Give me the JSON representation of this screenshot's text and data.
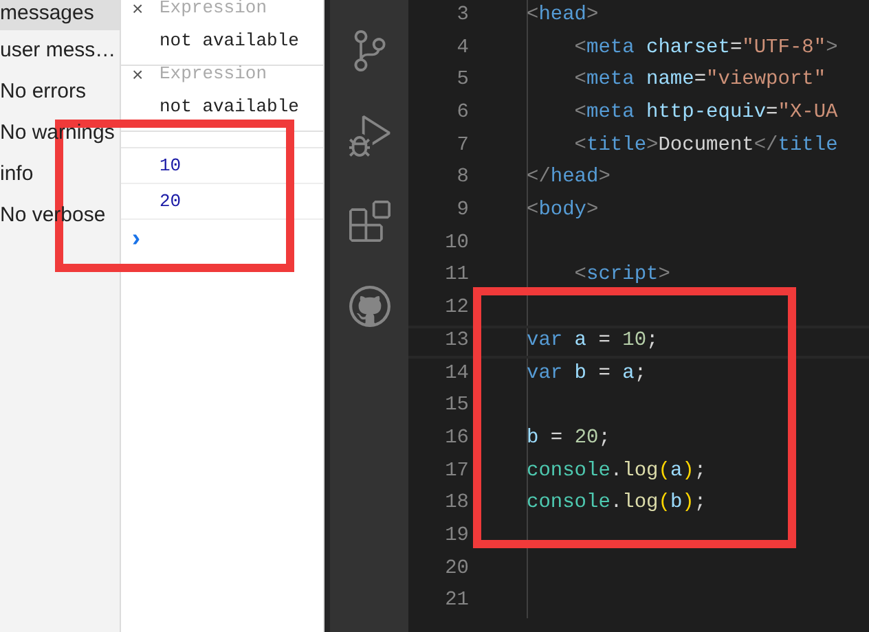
{
  "sidebar": {
    "items": [
      {
        "label": "messages",
        "selected": true
      },
      {
        "label": "user mess…",
        "selected": false
      },
      {
        "label": "No errors",
        "selected": false
      },
      {
        "label": "No warnings",
        "selected": false
      },
      {
        "label": "info",
        "selected": false
      },
      {
        "label": "No verbose",
        "selected": false
      }
    ]
  },
  "watch": [
    {
      "close": "×",
      "placeholder": "Expression",
      "value": "not available"
    },
    {
      "close": "×",
      "placeholder": "Expression",
      "value": "not available"
    }
  ],
  "console": {
    "output": [
      "10",
      "20"
    ],
    "prompt": "›"
  },
  "editor": {
    "lines": [
      {
        "number": "3",
        "current": false,
        "tokens": [
          {
            "text": "<",
            "kind": "punct"
          },
          {
            "text": "head",
            "kind": "tag"
          },
          {
            "text": ">",
            "kind": "punct"
          }
        ]
      },
      {
        "number": "4",
        "current": false,
        "tokens": [
          {
            "text": "    <",
            "kind": "punct"
          },
          {
            "text": "meta",
            "kind": "tag"
          },
          {
            "text": " charset",
            "kind": "attr"
          },
          {
            "text": "=",
            "kind": "plain"
          },
          {
            "text": "\"UTF-8\"",
            "kind": "string"
          },
          {
            "text": ">",
            "kind": "punct"
          }
        ]
      },
      {
        "number": "5",
        "current": false,
        "tokens": [
          {
            "text": "    <",
            "kind": "punct"
          },
          {
            "text": "meta",
            "kind": "tag"
          },
          {
            "text": " name",
            "kind": "attr"
          },
          {
            "text": "=",
            "kind": "plain"
          },
          {
            "text": "\"viewport\"",
            "kind": "string"
          }
        ]
      },
      {
        "number": "6",
        "current": false,
        "tokens": [
          {
            "text": "    <",
            "kind": "punct"
          },
          {
            "text": "meta",
            "kind": "tag"
          },
          {
            "text": " http-equiv",
            "kind": "attr"
          },
          {
            "text": "=",
            "kind": "plain"
          },
          {
            "text": "\"X-UA",
            "kind": "string"
          }
        ]
      },
      {
        "number": "7",
        "current": false,
        "tokens": [
          {
            "text": "    <",
            "kind": "punct"
          },
          {
            "text": "title",
            "kind": "tag"
          },
          {
            "text": ">",
            "kind": "punct"
          },
          {
            "text": "Document",
            "kind": "plain"
          },
          {
            "text": "</",
            "kind": "punct"
          },
          {
            "text": "title",
            "kind": "tag"
          }
        ]
      },
      {
        "number": "8",
        "current": false,
        "tokens": [
          {
            "text": "</",
            "kind": "punct"
          },
          {
            "text": "head",
            "kind": "tag"
          },
          {
            "text": ">",
            "kind": "punct"
          }
        ]
      },
      {
        "number": "9",
        "current": false,
        "tokens": [
          {
            "text": "<",
            "kind": "punct"
          },
          {
            "text": "body",
            "kind": "tag"
          },
          {
            "text": ">",
            "kind": "punct"
          }
        ]
      },
      {
        "number": "10",
        "current": false
      },
      {
        "number": "11",
        "current": false,
        "tokens": [
          {
            "text": "    <",
            "kind": "punct"
          },
          {
            "text": "script",
            "kind": "tag"
          },
          {
            "text": ">",
            "kind": "punct"
          }
        ]
      },
      {
        "number": "12",
        "current": false
      },
      {
        "number": "13",
        "current": true,
        "tokens": [
          {
            "text": "var",
            "kind": "keyword"
          },
          {
            "text": " a",
            "kind": "variable"
          },
          {
            "text": " = ",
            "kind": "plain"
          },
          {
            "text": "10",
            "kind": "number"
          },
          {
            "text": ";",
            "kind": "plain"
          }
        ]
      },
      {
        "number": "14",
        "current": false,
        "tokens": [
          {
            "text": "var",
            "kind": "keyword"
          },
          {
            "text": " b",
            "kind": "variable"
          },
          {
            "text": " = ",
            "kind": "plain"
          },
          {
            "text": "a",
            "kind": "variable"
          },
          {
            "text": ";",
            "kind": "plain"
          }
        ]
      },
      {
        "number": "15",
        "current": false
      },
      {
        "number": "16",
        "current": false,
        "tokens": [
          {
            "text": "b",
            "kind": "variable"
          },
          {
            "text": " = ",
            "kind": "plain"
          },
          {
            "text": "20",
            "kind": "number"
          },
          {
            "text": ";",
            "kind": "plain"
          }
        ]
      },
      {
        "number": "17",
        "current": false,
        "tokens": [
          {
            "text": "console",
            "kind": "class"
          },
          {
            "text": ".",
            "kind": "plain"
          },
          {
            "text": "log",
            "kind": "function"
          },
          {
            "text": "(",
            "kind": "paren"
          },
          {
            "text": "a",
            "kind": "variable"
          },
          {
            "text": ")",
            "kind": "paren"
          },
          {
            "text": ";",
            "kind": "plain"
          }
        ]
      },
      {
        "number": "18",
        "current": false,
        "tokens": [
          {
            "text": "console",
            "kind": "class"
          },
          {
            "text": ".",
            "kind": "plain"
          },
          {
            "text": "log",
            "kind": "function"
          },
          {
            "text": "(",
            "kind": "paren"
          },
          {
            "text": "b",
            "kind": "variable"
          },
          {
            "text": ")",
            "kind": "paren"
          },
          {
            "text": ";",
            "kind": "plain"
          }
        ]
      },
      {
        "number": "19",
        "current": false
      },
      {
        "number": "20",
        "current": false
      },
      {
        "number": "21",
        "current": false
      }
    ]
  }
}
